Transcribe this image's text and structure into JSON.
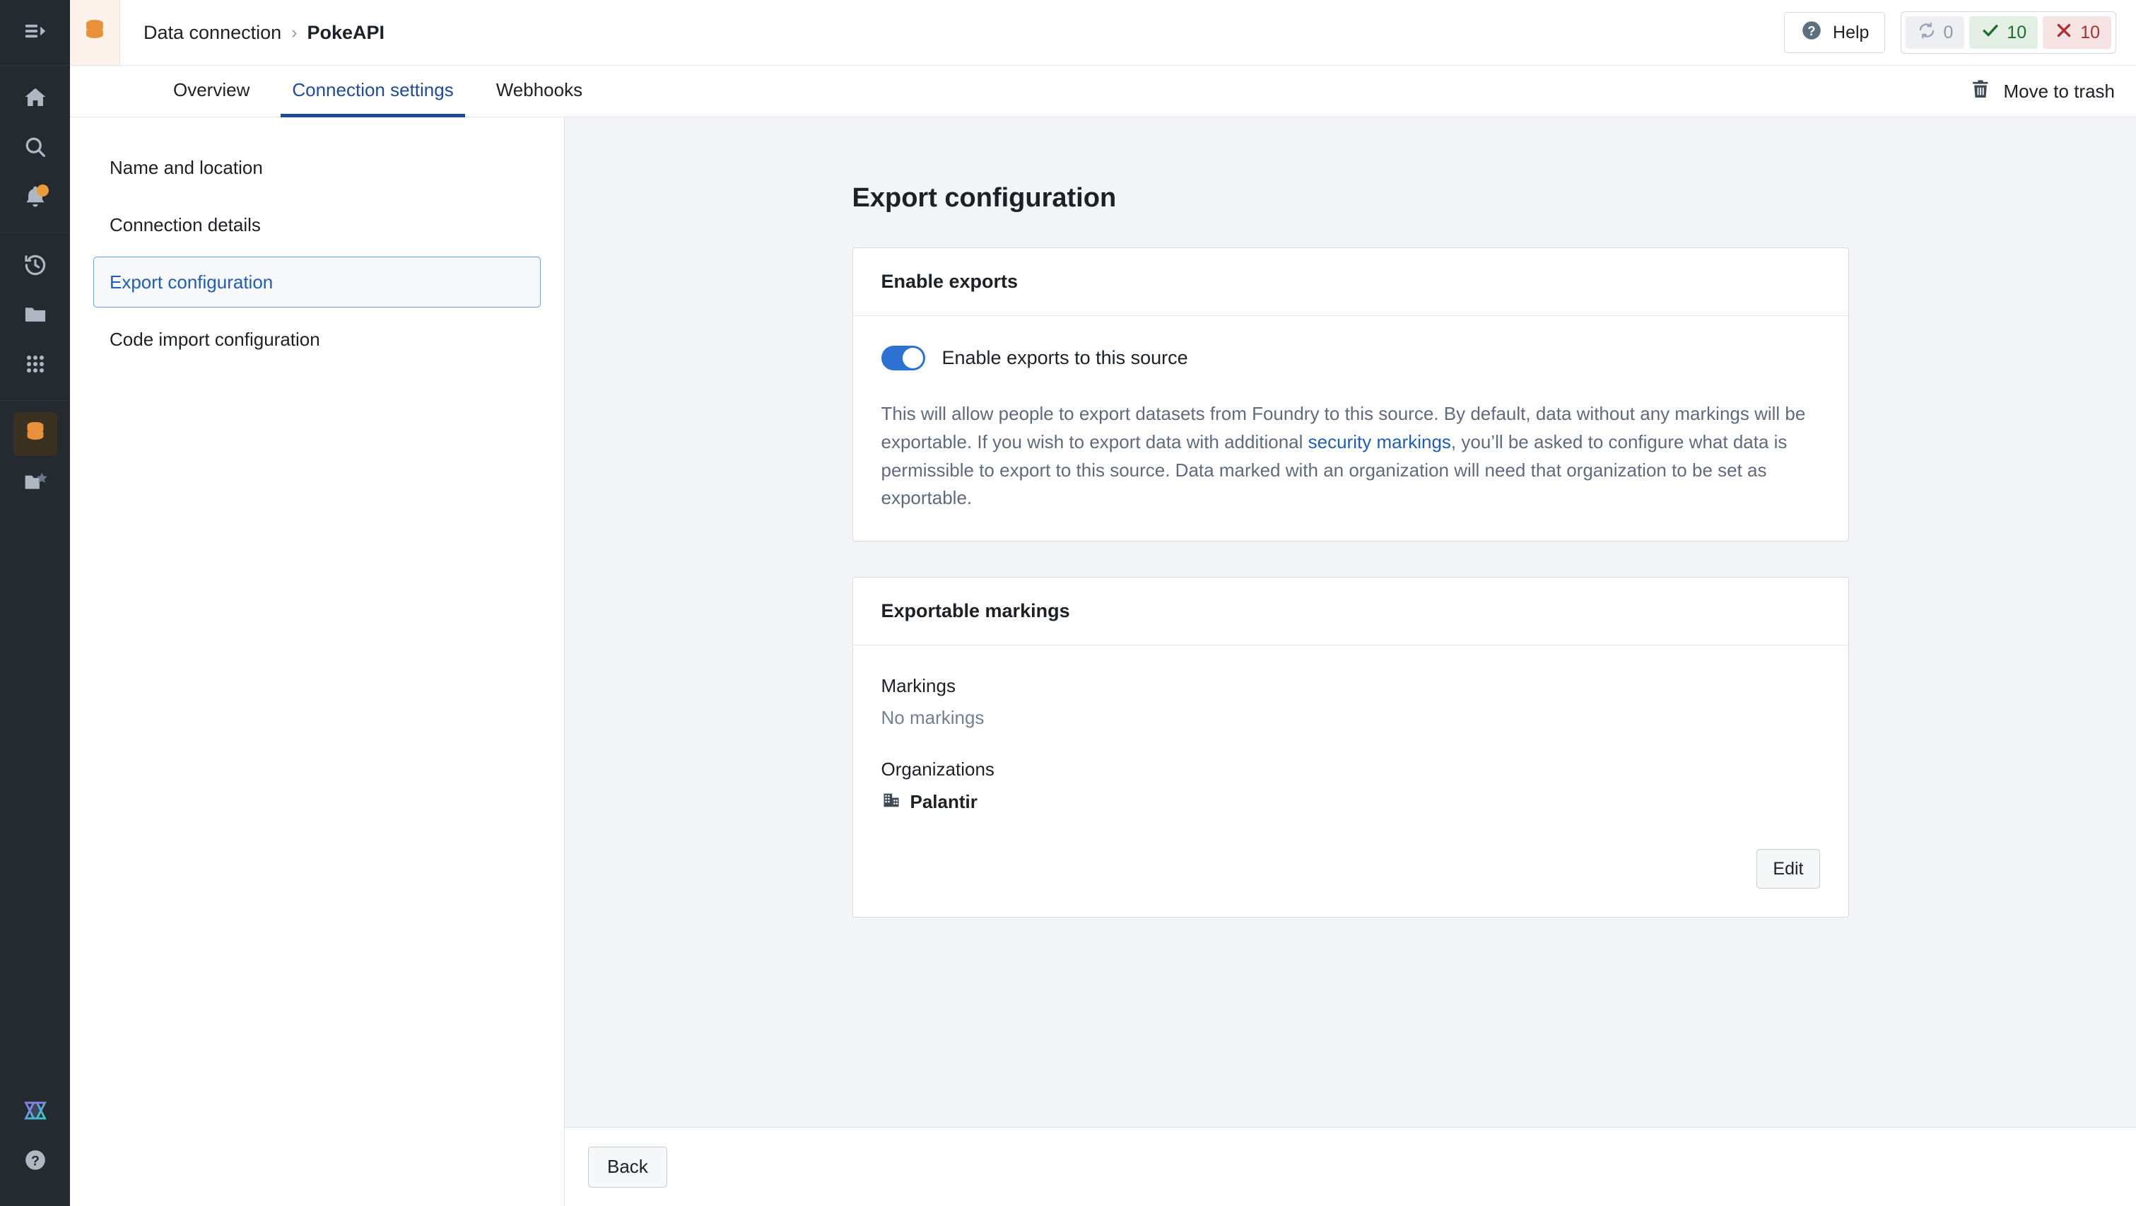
{
  "rail": {
    "collapse_icon": "sidebar-collapse-icon",
    "items": [
      {
        "id": "home",
        "icon": "home-icon"
      },
      {
        "id": "search",
        "icon": "search-icon"
      },
      {
        "id": "notifications",
        "icon": "bell-icon",
        "badge": true
      },
      {
        "id": "recent",
        "icon": "history-clock-icon"
      },
      {
        "id": "files",
        "icon": "folder-icon"
      },
      {
        "id": "apps",
        "icon": "grid-apps-icon"
      },
      {
        "id": "data-connection",
        "icon": "database-icon",
        "active": true
      },
      {
        "id": "favorites",
        "icon": "folder-star-icon"
      },
      {
        "id": "ontology",
        "icon": "hourglass-brand-icon"
      },
      {
        "id": "help",
        "icon": "question-circle-icon"
      }
    ]
  },
  "header": {
    "object_icon": "database-icon",
    "breadcrumb": {
      "parent": "Data connection",
      "separator": "›",
      "current": "PokeAPI"
    },
    "help_label": "Help",
    "help_icon": "question-circle-icon",
    "status": {
      "syncing": {
        "icon": "sync-arrows-icon",
        "count": "0"
      },
      "success": {
        "icon": "check-icon",
        "count": "10"
      },
      "failure": {
        "icon": "cross-icon",
        "count": "10"
      }
    }
  },
  "tabs": {
    "items": [
      {
        "label": "Overview",
        "active": false
      },
      {
        "label": "Connection settings",
        "active": true
      },
      {
        "label": "Webhooks",
        "active": false
      }
    ],
    "trash": {
      "label": "Move to trash",
      "icon": "trash-icon"
    }
  },
  "nav": {
    "items": [
      {
        "label": "Name and location",
        "active": false
      },
      {
        "label": "Connection details",
        "active": false
      },
      {
        "label": "Export configuration",
        "active": true
      },
      {
        "label": "Code import configuration",
        "active": false
      }
    ]
  },
  "main": {
    "page_title": "Export configuration",
    "enable_exports_card": {
      "header": "Enable exports",
      "toggle_label": "Enable exports to this source",
      "toggle_on": true,
      "description_part1": "This will allow people to export datasets from Foundry to this source. By default, data without any markings will be exportable. If you wish to export data with additional ",
      "description_link": "security markings",
      "description_part2": ", you’ll be asked to configure what data is permissible to export to this source. Data marked with an organization will need that organization to be set as exportable."
    },
    "markings_card": {
      "header": "Exportable markings",
      "markings_label": "Markings",
      "markings_value": "No markings",
      "organizations_label": "Organizations",
      "organization_name": "Palantir",
      "organization_icon": "office-building-icon",
      "edit_label": "Edit"
    }
  },
  "footer": {
    "back_label": "Back"
  },
  "colors": {
    "rail_bg": "#252A31",
    "accent_blue": "#2D72D2",
    "link_blue": "#215DB0",
    "tab_active": "#1F4B99",
    "orange": "#E8903A",
    "success_green": "#1C6E2E",
    "error_red": "#AC2F33",
    "content_bg": "#F3F4F7"
  }
}
